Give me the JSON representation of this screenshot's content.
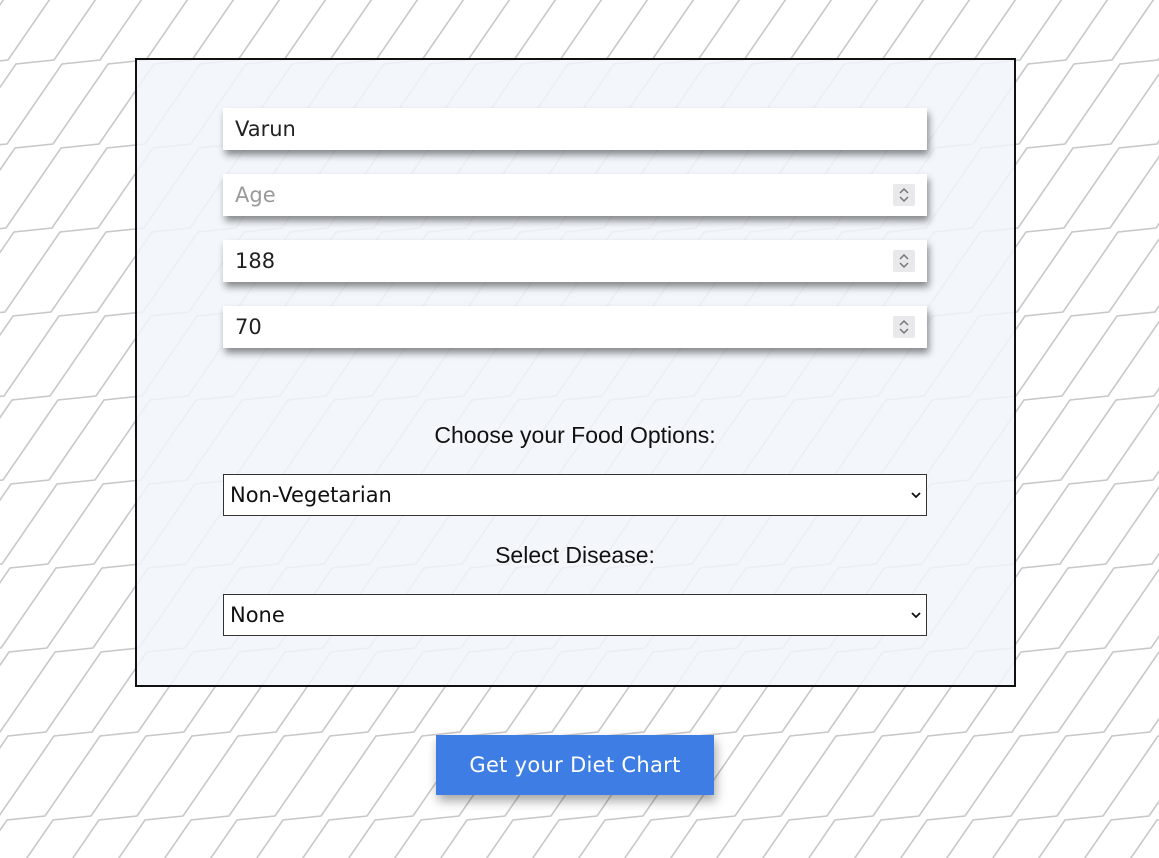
{
  "form": {
    "name_field": {
      "value": "Varun",
      "placeholder": ""
    },
    "age_field": {
      "value": "",
      "placeholder": "Age"
    },
    "height_field": {
      "value": "188"
    },
    "weight_field": {
      "value": "70"
    },
    "food_options_label": "Choose your Food Options:",
    "food_options_selected": "Non-Vegetarian",
    "disease_label": "Select Disease:",
    "disease_selected": "None"
  },
  "submit_label": "Get your Diet Chart",
  "colors": {
    "button": "#3e7ee4",
    "card_background": "#f1f6fc",
    "background_lines": "#c8c8c8"
  }
}
